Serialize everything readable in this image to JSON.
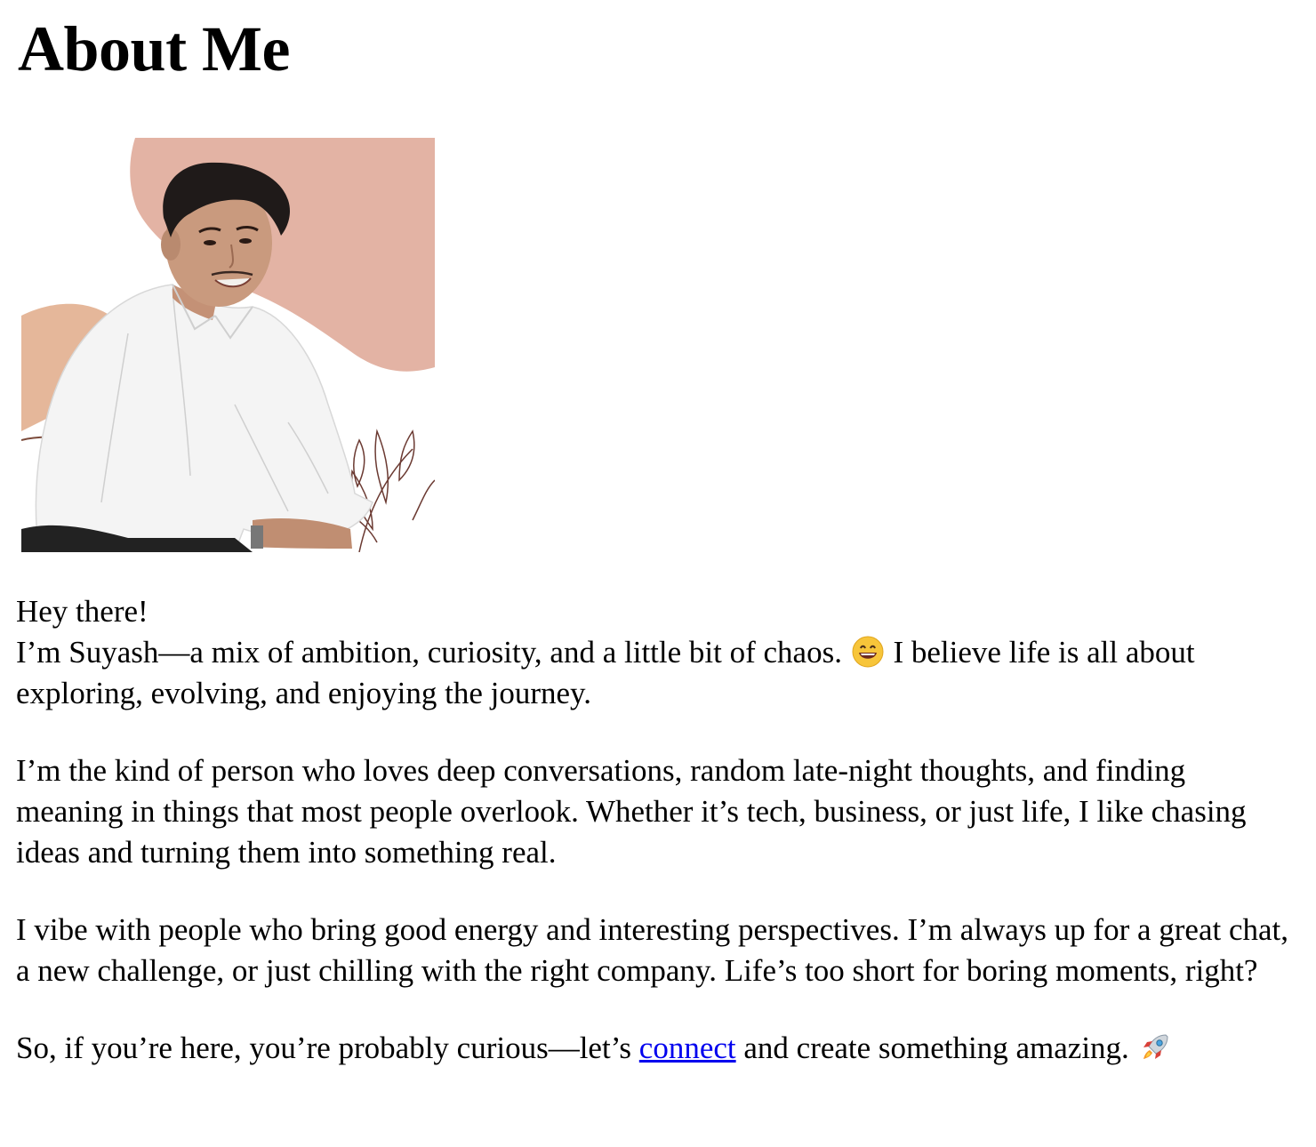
{
  "page": {
    "title": "About Me"
  },
  "portrait": {
    "alt": "Portrait photo of Suyash"
  },
  "about": {
    "greeting": "Hey there!",
    "intro_before_emoji": "I’m Suyash—a mix of ambition, curiosity, and a little bit of chaos.",
    "intro_emoji": "grinning-face-emoji",
    "intro_after_emoji": "I believe life is all about exploring, evolving, and enjoying the journey.",
    "paragraph_2": "I’m the kind of person who loves deep conversations, random late-night thoughts, and finding meaning in things that most people overlook. Whether it’s tech, business, or just life, I like chasing ideas and turning them into something real.",
    "paragraph_3": "I vibe with people who bring good energy and interesting perspectives. I’m always up for a great chat, a new challenge, or just chilling with the right company. Life’s too short for boring moments, right?",
    "closing_before_link": "So, if you’re here, you’re probably curious—let’s",
    "closing_link": "connect",
    "closing_after_link": "and create something amazing.",
    "closing_emoji": "rocket-emoji"
  },
  "colors": {
    "link": "#0000ee",
    "blob_pink": "#e3b3a4",
    "blob_tan": "#e5b79a"
  }
}
